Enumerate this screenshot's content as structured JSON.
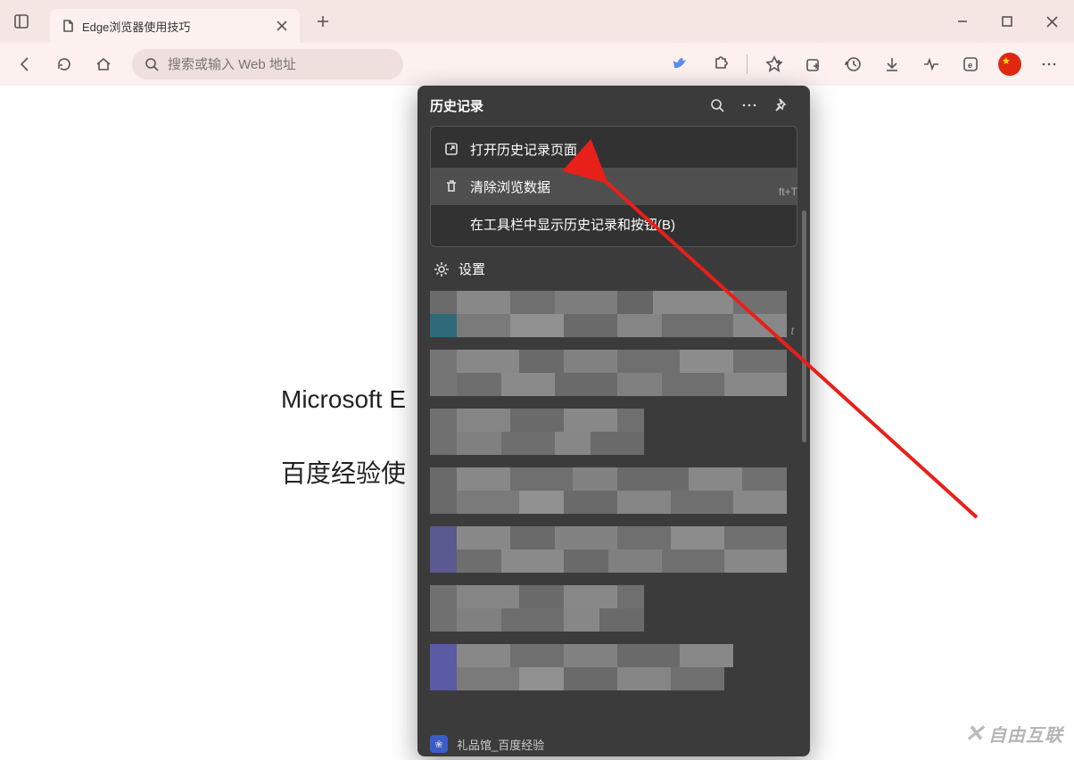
{
  "tab": {
    "title": "Edge浏览器使用技巧"
  },
  "address": {
    "placeholder": "搜索或输入 Web 地址"
  },
  "content": {
    "line1": "Microsoft E",
    "line2": "百度经验使"
  },
  "history": {
    "title": "历史记录",
    "menu": {
      "open_page": "打开历史记录页面",
      "clear_data": "清除浏览数据",
      "show_toolbar": "在工具栏中显示历史记录和按钮(B)"
    },
    "shortcut_hint": "ft+T",
    "settings_label": "设置",
    "side_char": "t",
    "bottom_label": "礼品馆_百度经验"
  },
  "watermark": {
    "text": "自由互联"
  }
}
